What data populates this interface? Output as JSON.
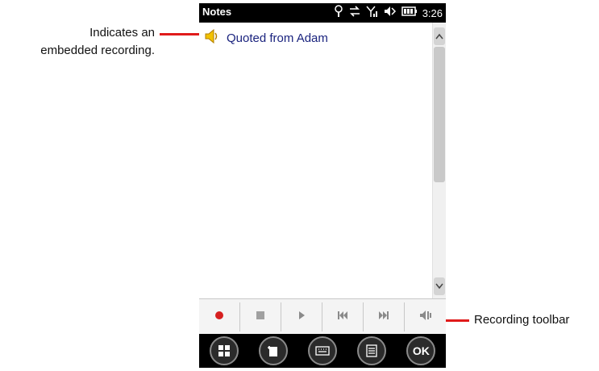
{
  "callouts": {
    "embedded_line1": "Indicates an",
    "embedded_line2": "embedded recording.",
    "toolbar": "Recording toolbar"
  },
  "statusbar": {
    "app_title": "Notes",
    "time": "3:26",
    "icons": [
      "signal-strength-icon",
      "sync-icon",
      "antenna-icon",
      "volume-icon",
      "battery-icon"
    ]
  },
  "note": {
    "text": "Quoted from Adam",
    "icon": "speaker-icon"
  },
  "recording_toolbar": {
    "buttons": [
      "record-icon",
      "stop-icon",
      "play-icon",
      "previous-icon",
      "next-icon",
      "volume-icon"
    ]
  },
  "softkeys": {
    "ok_label": "OK",
    "buttons": [
      "windows-start-icon",
      "new-note-icon",
      "keyboard-icon",
      "menu-icon",
      "ok-button"
    ]
  },
  "colors": {
    "accent_red": "#e01b1b",
    "note_text": "#1a237e",
    "record_red": "#d62020"
  }
}
